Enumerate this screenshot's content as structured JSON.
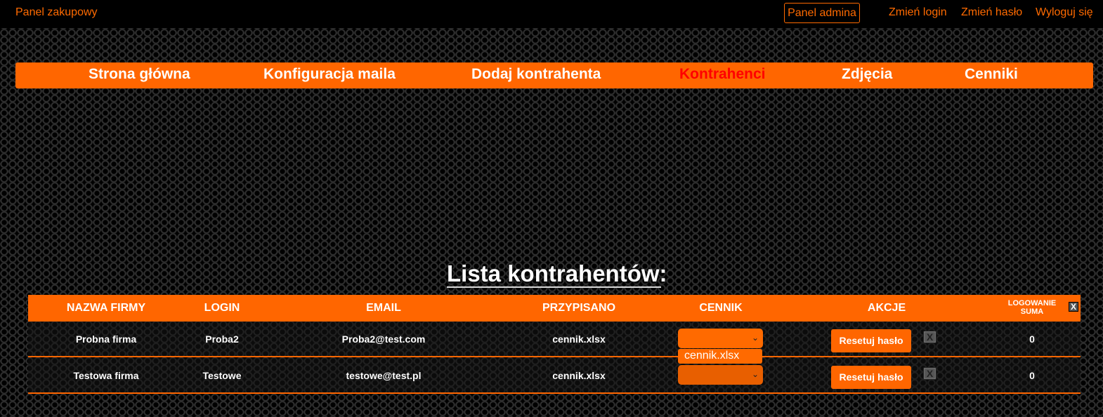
{
  "topbar": {
    "brand": "Panel zakupowy",
    "admin_button": "Panel admina",
    "links": [
      "Zmień login",
      "Zmień hasło",
      "Wyloguj się"
    ]
  },
  "nav": {
    "items": [
      "Strona główna",
      "Konfiguracja maila",
      "Dodaj kontrahenta",
      "Kontrahenci",
      "Zdjęcia",
      "Cenniki"
    ],
    "active": "Kontrahenci"
  },
  "page_title": "Lista kontrahentów:",
  "table": {
    "headers": [
      "NAZWA FIRMY",
      "LOGIN",
      "EMAIL",
      "PRZYPISANO",
      "CENNIK",
      "AKCJE"
    ],
    "logins_header": [
      "LOGOWANIE",
      "SUMA"
    ],
    "clear_button": "X",
    "rows": [
      {
        "firma": "Probna firma",
        "login": "Proba2",
        "email": "Proba2@test.com",
        "przypisano": "cennik.xlsx",
        "reset": "Resetuj hasło",
        "delete": "X",
        "logowanie": "0"
      },
      {
        "firma": "Testowa firma",
        "login": "Testowe",
        "email": "testowe@test.pl",
        "przypisano": "cennik.xlsx",
        "reset": "Resetuj hasło",
        "delete": "X",
        "logowanie": "0"
      }
    ],
    "dropdown_option": "cennik.xlsx"
  },
  "colors": {
    "accent": "#ff6600",
    "active_nav": "#ff0000",
    "topbar": "#000000"
  }
}
